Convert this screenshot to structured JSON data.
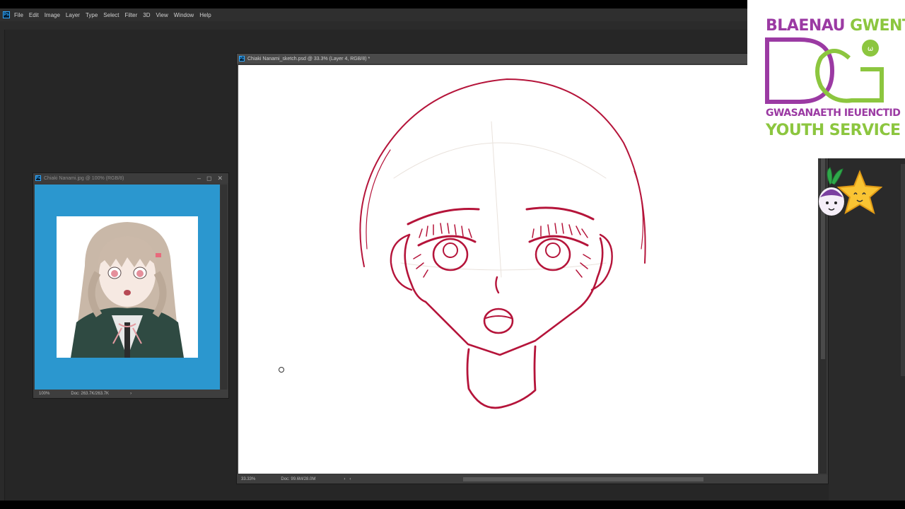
{
  "app": {
    "logo_label": "Ps",
    "menu": [
      "File",
      "Edit",
      "Image",
      "Layer",
      "Type",
      "Select",
      "Filter",
      "3D",
      "View",
      "Window",
      "Help"
    ]
  },
  "reference_window": {
    "title": "Chiaki Nanami.jpg @ 100% (RGB/8)",
    "zoom": "100%",
    "doc_info": "Doc: 263.7K/263.7K",
    "canvas_color": "#2b97cf"
  },
  "main_window": {
    "title": "Chiaki Nanami_sketch.psd @ 33.3% (Layer 4, RGB/8) *",
    "zoom": "33.33%",
    "doc_info": "Doc: 99.6M/28.0M",
    "sketch_color": "#b5143a"
  },
  "overlay": {
    "logo_line1_a": "BLAENAU ",
    "logo_line1_b": "GWENT",
    "logo_line2": "GWASANAETH IEUENCTID",
    "logo_line3": "YOUTH SERVICE",
    "purple": "#9b3aa3",
    "green": "#8cc63f"
  }
}
